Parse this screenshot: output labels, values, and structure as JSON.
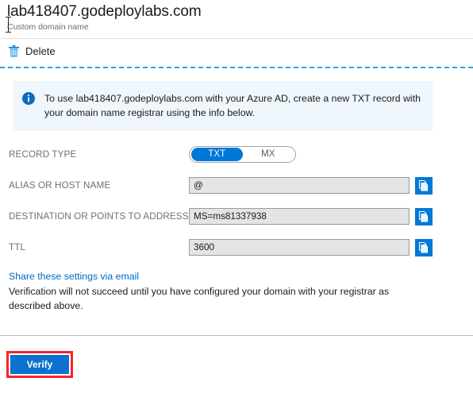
{
  "header": {
    "title": "lab418407.godeploylabs.com",
    "subtitle": "Custom domain name"
  },
  "commandbar": {
    "delete_label": "Delete",
    "delete_icon": "trash-icon"
  },
  "banner": {
    "icon": "info-icon",
    "text": "To use lab418407.godeploylabs.com with your Azure AD, create a new TXT record with your domain name registrar using the info below.",
    "background": "#eff6fc"
  },
  "form": {
    "record_type": {
      "label": "RECORD TYPE",
      "options": [
        "TXT",
        "MX"
      ],
      "selected": "TXT"
    },
    "fields": [
      {
        "label": "ALIAS OR HOST NAME",
        "value": "@",
        "copy_icon": "copy-icon"
      },
      {
        "label": "DESTINATION OR POINTS TO ADDRESS",
        "value": "MS=ms81337938",
        "copy_icon": "copy-icon"
      },
      {
        "label": "TTL",
        "value": "3600",
        "copy_icon": "copy-icon"
      }
    ]
  },
  "footer": {
    "share_link": "Share these settings via email",
    "note": "Verification will not succeed until you have configured your domain with your registrar as described above."
  },
  "actions": {
    "verify_label": "Verify"
  },
  "colors": {
    "accent": "#0078d7",
    "link": "#0069c0",
    "annotation": "#f4252b",
    "dashed_separator": "#22a7e8"
  }
}
